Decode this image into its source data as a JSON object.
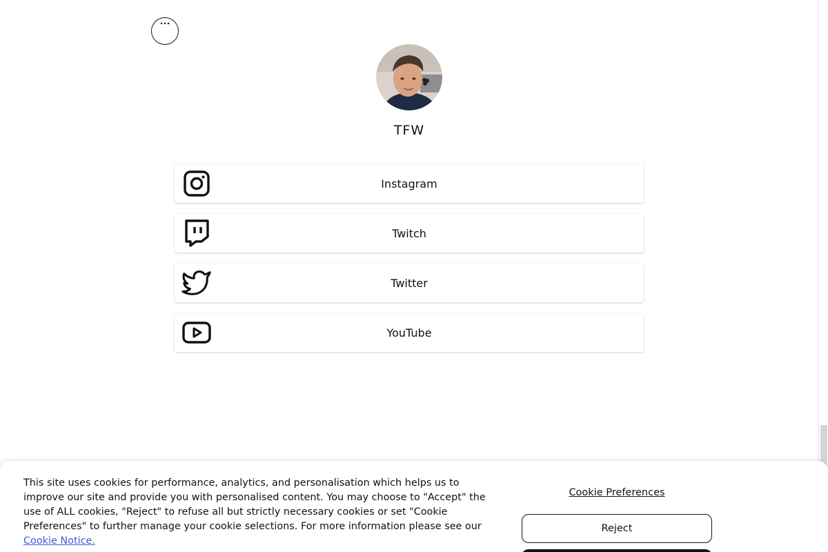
{
  "profile": {
    "name": "TFW",
    "avatar_icon": "profile-photo"
  },
  "menu": {
    "more_icon": "more-dots-icon"
  },
  "links": [
    {
      "label": "Instagram",
      "icon": "instagram-icon"
    },
    {
      "label": "Twitch",
      "icon": "twitch-icon"
    },
    {
      "label": "Twitter",
      "icon": "twitter-icon"
    },
    {
      "label": "YouTube",
      "icon": "youtube-icon"
    }
  ],
  "cookie_banner": {
    "text": "This site uses cookies for performance, analytics, and personalisation which helps us to improve our site and provide you with personalised content. You may choose to \"Accept\" the use of ALL cookies, \"Reject\" to refuse all but strictly necessary cookies or set \"Cookie Preferences\" to further manage your cookie selections. For more information please see our",
    "notice_link": "Cookie Notice.",
    "preferences_label": "Cookie Preferences",
    "reject_label": "Reject",
    "accept_label": ""
  },
  "colors": {
    "link_blue": "#3b5bdb",
    "text": "#111111",
    "background": "#ffffff"
  }
}
